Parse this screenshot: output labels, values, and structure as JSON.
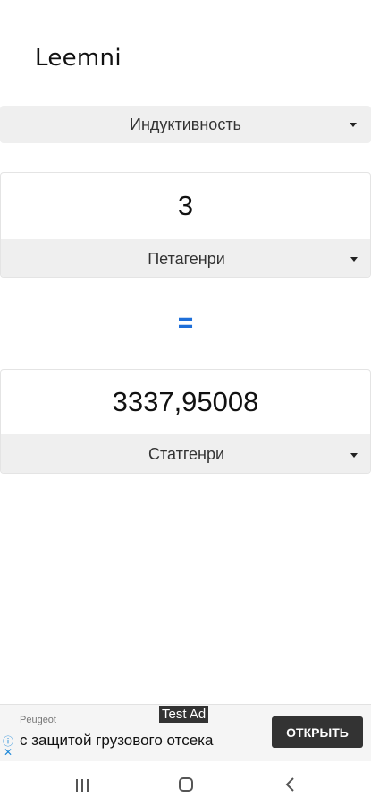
{
  "app": {
    "title": "Leemni"
  },
  "category": {
    "selected": "Индуктивность"
  },
  "from": {
    "value": "3",
    "unit": "Петагенри"
  },
  "equals": "=",
  "to": {
    "value": "3337,95008",
    "unit": "Статгенри"
  },
  "ad": {
    "tag": "Test Ad",
    "brand": "Peugeot",
    "text": "с защитой грузового отсека",
    "button": "ОТКРЫТЬ"
  },
  "navbar": {
    "recents_icon": "recents-icon",
    "home_icon": "home-icon",
    "back_icon": "back-icon"
  },
  "colors": {
    "accent": "#1e6fd9",
    "dropdown_bg": "#efefef",
    "ad_button": "#333333"
  }
}
